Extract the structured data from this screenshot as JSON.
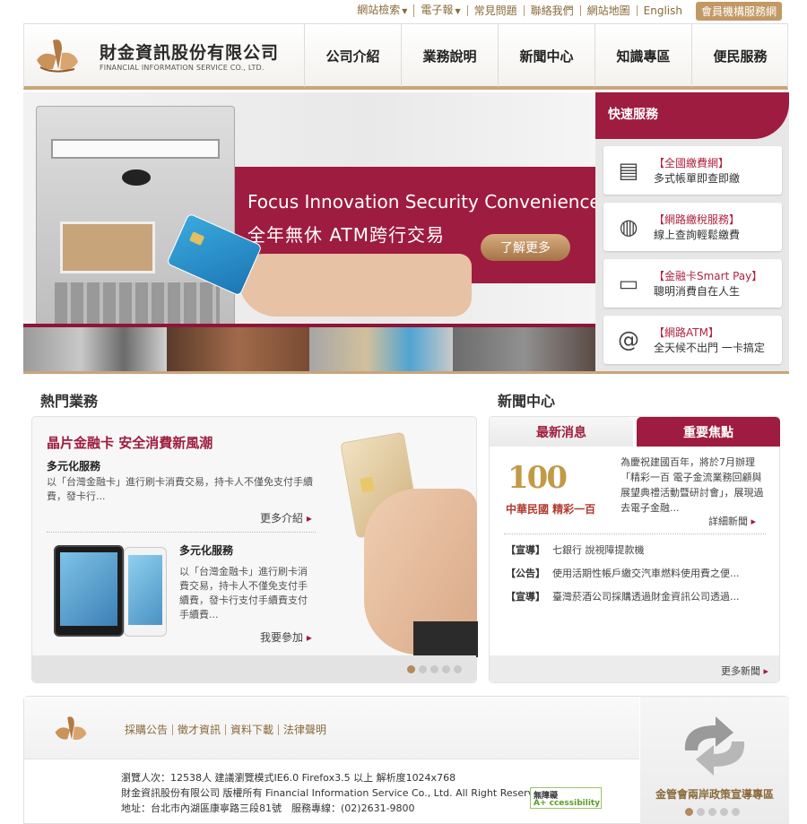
{
  "topbar": {
    "items": [
      "網站檢索",
      "電子報",
      "常見問題",
      "聯絡我們",
      "網站地圖",
      "English"
    ],
    "member_label": "會員機構服務網"
  },
  "brand": {
    "name_zh": "財金資訊股份有限公司",
    "name_en": "FINANCIAL INFORMATION SERVICE CO., LTD."
  },
  "nav": {
    "items": [
      "公司介紹",
      "業務說明",
      "新聞中心",
      "知識專區",
      "便民服務"
    ]
  },
  "banner": {
    "tagline_en": "Focus Innovation Security Convenience",
    "tagline_zh": "全年無休 ATM跨行交易",
    "more_label": "了解更多"
  },
  "quick_service": {
    "title": "快速服務",
    "items": [
      {
        "title": "【全國繳費網】",
        "desc": "多式帳單即查即繳",
        "icon": "bill-icon"
      },
      {
        "title": "【網路繳稅服務】",
        "desc": "線上查詢輕鬆繳費",
        "icon": "globe-icon"
      },
      {
        "title": "【金融卡Smart Pay】",
        "desc": "聰明消費自在人生",
        "icon": "card-reader-icon"
      },
      {
        "title": "【網路ATM】",
        "desc": "全天候不出門 一卡搞定",
        "icon": "at-icon"
      }
    ]
  },
  "hot": {
    "title": "熱門業務",
    "headline": "晶片金融卡 安全消費新風潮",
    "block1": {
      "subtitle": "多元化服務",
      "desc": "以「台灣金融卡」進行刷卡消費交易，持卡人不僅免支付手續費，發卡行...",
      "link": "更多介紹"
    },
    "block2": {
      "subtitle": "多元化服務",
      "desc": "以「台灣金融卡」進行刷卡消費交易，持卡人不僅免支付手續費，發卡行支付手續費支付手續費...",
      "link": "我要參加"
    }
  },
  "news": {
    "title": "新聞中心",
    "tab_latest": "最新消息",
    "tab_focus": "重要焦點",
    "feature_logo": "100",
    "feature_caption": "中華民國 精彩一百",
    "feature_desc": "為慶祝建國百年，將於7月辦理「精彩一百 電子金流業務回顧與展望典禮活動暨研討會」，展現過去電子金融...",
    "detail_link": "詳細新聞",
    "items": [
      {
        "tag": "【宣導】",
        "text": "七銀行 說視障提款機"
      },
      {
        "tag": "【公告】",
        "text": "使用活期性帳戶繳交汽車燃料使用費之便..."
      },
      {
        "tag": "【宣導】",
        "text": "臺灣菸酒公司採購透過財金資訊公司透過..."
      }
    ],
    "more_link": "更多新聞"
  },
  "footer": {
    "links": [
      "採購公告",
      "徵才資訊",
      "資料下載",
      "法律聲明"
    ],
    "info_line1": "瀏覽人次：12538人 建議瀏覽模式IE6.0 Firefox3.5 以上 解析度1024x768",
    "info_line2": "財金資訊股份有限公司 版權所有 Financial Information Service Co., Ltd. All Right Reserved.",
    "info_line3": "地址：台北市內湖區康寧路三段81號　服務專線：(02)2631-9800",
    "acc_top": "無障礙",
    "acc_bottom": "A+ ccessibility",
    "promo_caption": "金管會兩岸政策宣導專區"
  },
  "colors": {
    "brand_red": "#9e1c3f",
    "brand_gold": "#c29965"
  }
}
